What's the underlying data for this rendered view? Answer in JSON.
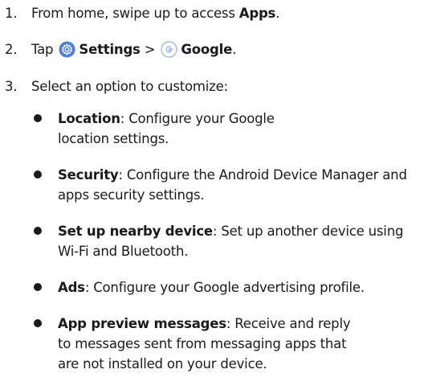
{
  "steps": [
    {
      "num": "1.",
      "pre": "From home, swipe up to access ",
      "bold": "Apps",
      "post": "."
    },
    {
      "num": "2.",
      "pre": "Tap ",
      "bold1": "Settings",
      "sep": " > ",
      "bold2": "Google",
      "post": "."
    },
    {
      "num": "3.",
      "text": "Select an option to customize:"
    }
  ],
  "options": [
    {
      "term": "Location",
      "desc": ": Configure your Google location settings."
    },
    {
      "term": "Security",
      "desc": ": Configure the Android Device Manager and apps security settings."
    },
    {
      "term": "Set up nearby device",
      "desc": ": Set up another device using Wi-Fi and Bluetooth."
    },
    {
      "term": "Ads",
      "desc": ": Configure your Google advertising profile."
    },
    {
      "term": "App preview messages",
      "desc": ": Receive and reply to messages sent from messaging apps that are not installed on your device."
    }
  ],
  "icons": {
    "settings": "settings-gear-icon",
    "google": "google-g-icon"
  },
  "colors": {
    "settings_icon_bg": "#4f7fd6",
    "google_icon_stroke": "#9bb3e8",
    "text": "#1a1a1a"
  }
}
